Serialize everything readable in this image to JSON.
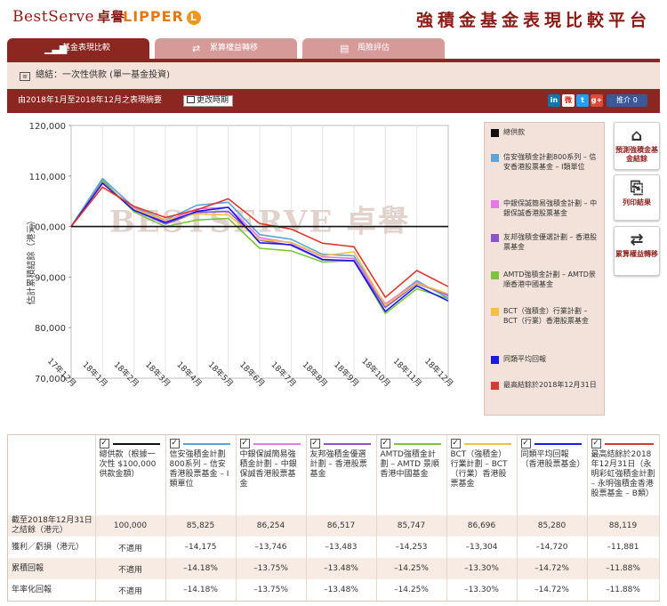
{
  "header": {
    "brand_en": "BestServe",
    "brand_cn": "卓譽",
    "partner": "LIPPER",
    "partner_mark": "L",
    "title": "強積金基金表現比較平台"
  },
  "tabs": [
    {
      "label": "基金表現比較",
      "icon": "bar-chart-icon",
      "active": true
    },
    {
      "label": "累算權益轉移",
      "icon": "swap-arrows-icon",
      "active": false
    },
    {
      "label": "風險評估",
      "icon": "document-icon",
      "active": false
    }
  ],
  "breadcrumb": "總結：一次性供款 (單一基金投資)",
  "period": {
    "summary": "由2018年1月至2018年12月之表現摘要",
    "change_button": "更改時期"
  },
  "share": {
    "fb_label": "推介 0",
    "icons": [
      "linkedin-icon",
      "weibo-icon",
      "twitter-icon",
      "google-plus-icon"
    ]
  },
  "chart_data": {
    "type": "line",
    "ylabel": "估計累積結餘（港元）",
    "ylim": [
      70000,
      120000
    ],
    "yticks": [
      "120,000",
      "110,000",
      "100,000",
      "90,000",
      "80,000",
      "70,000"
    ],
    "categories": [
      "17年12月",
      "18年1月",
      "18年2月",
      "18年3月",
      "18年4月",
      "18年5月",
      "18年6月",
      "18年7月",
      "18年8月",
      "18年9月",
      "18年10月",
      "18年11月",
      "18年12月"
    ],
    "watermark": "BESTSERVE 卓譽",
    "series": [
      {
        "name": "總供款",
        "color": "#111111",
        "values": [
          100000,
          100000,
          100000,
          100000,
          100000,
          100000,
          100000,
          100000,
          100000,
          100000,
          100000,
          100000,
          100000
        ]
      },
      {
        "name": "信安強積金計劃800系列 – 信安香港股票基金 – I類單位",
        "color": "#5aa5dc",
        "values": [
          100000,
          109500,
          103800,
          101300,
          104200,
          104800,
          98400,
          97500,
          94500,
          94200,
          84500,
          89300,
          85825
        ]
      },
      {
        "name": "中銀保誠簡易強積金計劃 – 中銀保誠香港股票基金",
        "color": "#e878e8",
        "values": [
          100000,
          108500,
          103700,
          101000,
          103500,
          103800,
          97800,
          96800,
          94000,
          93700,
          84700,
          89000,
          86254
        ]
      },
      {
        "name": "友邦強積金優選計劃 – 香港股票基金",
        "color": "#8a55c8",
        "values": [
          100000,
          108800,
          103300,
          100500,
          102800,
          103000,
          97300,
          96300,
          93400,
          93300,
          84000,
          88700,
          86517
        ]
      },
      {
        "name": "AMTD強積金計劃 – AMTD景順香港中國基金",
        "color": "#7cc43c",
        "values": [
          100000,
          109200,
          102900,
          100000,
          101300,
          101600,
          95700,
          95200,
          93000,
          93300,
          82800,
          87700,
          85747
        ]
      },
      {
        "name": "BCT（強積金）行業計劃 – BCT（行業）香港股票基金",
        "color": "#f5c040",
        "values": [
          100000,
          108700,
          103400,
          101300,
          102500,
          102300,
          97400,
          96900,
          94200,
          95000,
          84400,
          88800,
          86696
        ]
      },
      {
        "name": "同類平均回報",
        "color": "#1a1ae6",
        "values": [
          100000,
          108600,
          103200,
          100800,
          103000,
          103800,
          96800,
          96400,
          93500,
          93200,
          83200,
          88300,
          85280
        ]
      },
      {
        "name": "最高結餘於2018年12月31日",
        "color": "#d83a30",
        "values": [
          100000,
          107800,
          104000,
          101800,
          103300,
          105500,
          100600,
          99500,
          96700,
          96000,
          86000,
          91300,
          88119
        ]
      }
    ]
  },
  "legend": [
    {
      "label": "總供款",
      "color": "#111111"
    },
    {
      "label": "信安強積金計劃800系列 – 信安香港股票基金 – I類單位",
      "color": "#5aa5dc"
    },
    {
      "label": "中銀保誠簡易強積金計劃 – 中銀保誠香港股票基金",
      "color": "#e878e8"
    },
    {
      "label": "友邦強積金優選計劃 – 香港股票基金",
      "color": "#8a55c8"
    },
    {
      "label": "AMTD強積金計劃 – AMTD景順香港中國基金",
      "color": "#7cc43c"
    },
    {
      "label": "BCT（強積金）行業計劃 – BCT（行業）香港股票基金",
      "color": "#f5c040"
    },
    {
      "label": "同類平均回報",
      "color": "#1a1ae6"
    },
    {
      "label": "最高結餘於2018年12月31日",
      "color": "#d83a30"
    }
  ],
  "side_buttons": [
    {
      "label": "預測強積金基金結餘",
      "icon": "projection-icon"
    },
    {
      "label": "列印結果",
      "icon": "print-icon"
    },
    {
      "label": "累算權益轉移",
      "icon": "transfer-icon"
    }
  ],
  "table": {
    "checkmark": "✓",
    "columns": [
      {
        "header": "總供款（根據一次性 $100,000 供款金額）",
        "color": "#111111"
      },
      {
        "header": "信安強積金計劃800系列 – 信安香港股票基金 – I類單位",
        "color": "#5aa5dc"
      },
      {
        "header": "中銀保誠簡易強積金計劃 – 中銀保誠香港股票基金",
        "color": "#e878e8"
      },
      {
        "header": "友邦強積金優選計劃 – 香港股票基金",
        "color": "#8a55c8"
      },
      {
        "header": "AMTD強積金計劃 – AMTD 景順香港中國基金",
        "color": "#7cc43c"
      },
      {
        "header": "BCT（強積金）行業計劃 – BCT（行業）香港股票基金",
        "color": "#f5c040"
      },
      {
        "header": "同類平均回報（香港股票基金）",
        "color": "#1a1ae6"
      },
      {
        "header": "最高結餘於2018年12月31日（永明彩虹強積金計劃 – 永明強積金香港股票基金 – B類）",
        "color": "#d83a30"
      }
    ],
    "rows": [
      {
        "label": "截至2018年12月31日之結餘（港元）",
        "cells": [
          "100,000",
          "85,825",
          "86,254",
          "86,517",
          "85,747",
          "86,696",
          "85,280",
          "88,119"
        ]
      },
      {
        "label": "獲利／虧損（港元）",
        "cells": [
          "不適用",
          "–14,175",
          "–13,746",
          "–13,483",
          "–14,253",
          "–13,304",
          "–14,720",
          "–11,881"
        ]
      },
      {
        "label": "累積回報",
        "cells": [
          "不適用",
          "–14.18%",
          "–13.75%",
          "–13.48%",
          "–14.25%",
          "–13.30%",
          "–14.72%",
          "–11.88%"
        ]
      },
      {
        "label": "年率化回報",
        "cells": [
          "不適用",
          "–14.18%",
          "–13.75%",
          "–13.48%",
          "–14.25%",
          "–13.30%",
          "–14.72%",
          "–11.88%"
        ]
      }
    ]
  }
}
